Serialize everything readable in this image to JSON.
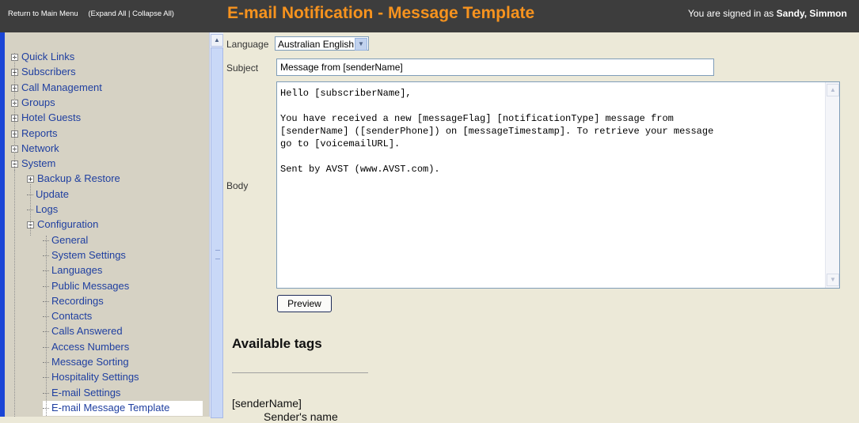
{
  "header": {
    "return_link": "Return to Main Menu",
    "expand_collapse": "(Expand All | Collapse All)",
    "title": "E-mail Notification - Message Template",
    "signed_in_prefix": "You are signed in as ",
    "user_name": "Sandy, Simmon"
  },
  "sidebar": {
    "items": [
      {
        "label": "Quick Links",
        "icon": "expand-plus-icon"
      },
      {
        "label": "Subscribers",
        "icon": "expand-plus-icon"
      },
      {
        "label": "Call Management",
        "icon": "expand-plus-icon"
      },
      {
        "label": "Groups",
        "icon": "expand-plus-icon"
      },
      {
        "label": "Hotel Guests",
        "icon": "expand-plus-icon"
      },
      {
        "label": "Reports",
        "icon": "expand-plus-icon"
      },
      {
        "label": "Network",
        "icon": "expand-plus-icon"
      },
      {
        "label": "System",
        "icon": "collapse-minus-icon"
      },
      {
        "label": "Backup & Restore",
        "icon": "expand-plus-icon"
      },
      {
        "label": "Update"
      },
      {
        "label": "Logs"
      },
      {
        "label": "Configuration",
        "icon": "collapse-minus-icon"
      },
      {
        "label": "General"
      },
      {
        "label": "System Settings"
      },
      {
        "label": "Languages"
      },
      {
        "label": "Public Messages"
      },
      {
        "label": "Recordings"
      },
      {
        "label": "Contacts"
      },
      {
        "label": "Calls Answered"
      },
      {
        "label": "Access Numbers"
      },
      {
        "label": "Message Sorting"
      },
      {
        "label": "Hospitality Settings"
      },
      {
        "label": "E-mail Settings"
      },
      {
        "label": "E-mail Message Template",
        "selected": true
      }
    ]
  },
  "form": {
    "language_label": "Language",
    "language_value": "Australian English",
    "subject_label": "Subject",
    "subject_value": "Message from [senderName]",
    "body_label": "Body",
    "body_value": "Hello [subscriberName],\n\nYou have received a new [messageFlag] [notificationType] message from\n[senderName] ([senderPhone]) on [messageTimestamp]. To retrieve your message\ngo to [voicemailURL].\n\nSent by AVST (www.AVST.com).",
    "preview_label": "Preview"
  },
  "tags": {
    "heading": "Available tags",
    "first_tag": "[senderName]",
    "first_desc": "Sender's name"
  }
}
